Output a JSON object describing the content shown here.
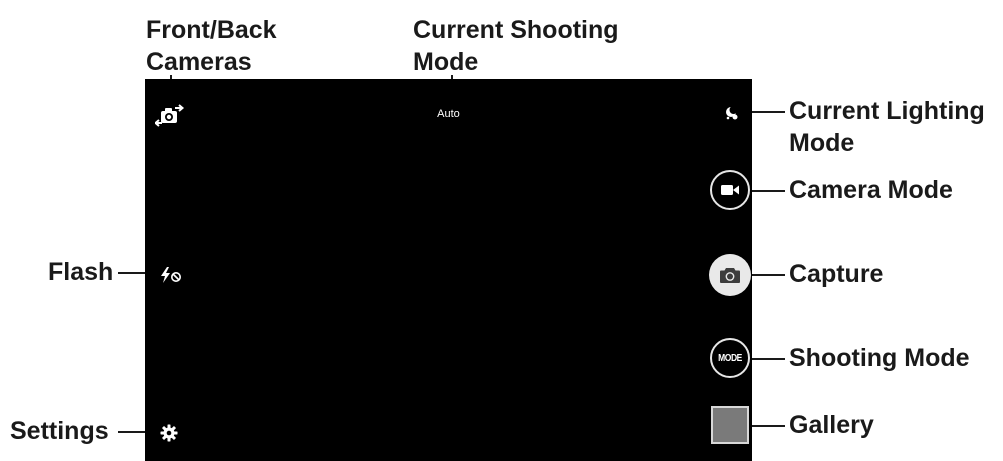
{
  "viewfinder": {
    "current_mode_text": "Auto",
    "mode_button_text": "MODE"
  },
  "callouts": {
    "front_back": [
      "Front/Back",
      "Cameras"
    ],
    "shooting_mode_current": [
      "Current Shooting",
      "Mode"
    ],
    "lighting": [
      "Current Lighting",
      "Mode"
    ],
    "camera_mode": "Camera Mode",
    "capture": "Capture",
    "shooting_mode": "Shooting Mode",
    "gallery": "Gallery",
    "flash": "Flash",
    "settings": "Settings"
  },
  "icons": {
    "switch_camera": "switch-camera-icon",
    "flash_off": "flash-off-icon",
    "settings": "gear-icon",
    "lighting": "lighting-mode-icon",
    "video": "video-camera-icon",
    "capture": "camera-icon"
  },
  "colors": {
    "viewfinder_bg": "#000000",
    "label_text": "#1a1a1a",
    "capture_button": "#e9e9e9",
    "gallery_thumbnail": "#7a7a7a"
  }
}
